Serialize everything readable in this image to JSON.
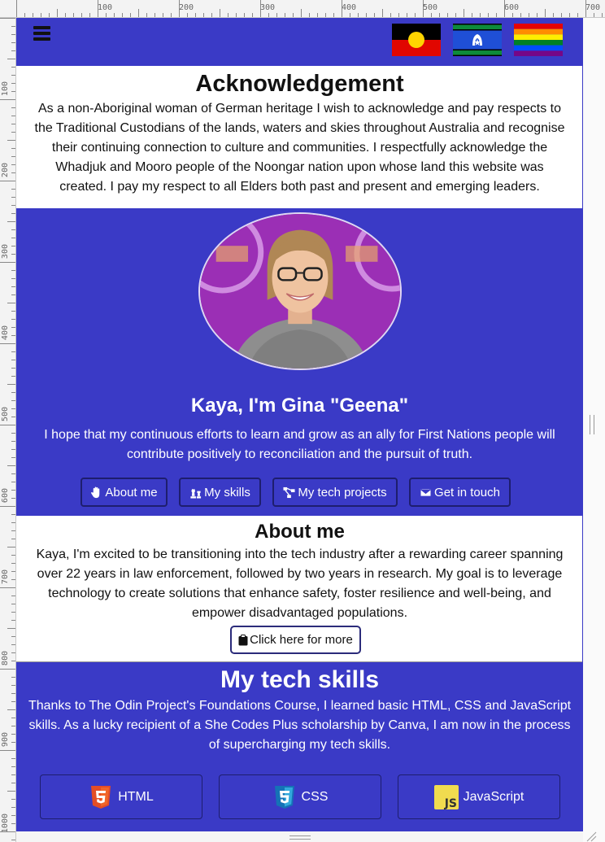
{
  "ruler": {
    "h_labels": [
      "100",
      "200",
      "300",
      "400",
      "500",
      "600",
      "700"
    ],
    "v_labels": [
      "100",
      "200",
      "300",
      "400",
      "500",
      "600",
      "700",
      "800",
      "900",
      "1000"
    ]
  },
  "colors": {
    "brand": "#3a3ac6",
    "button_border": "#1e1e6e",
    "text_on_blue": "#ffffff"
  },
  "nav": {
    "menu_icon": "hamburger-icon",
    "flags": [
      "aboriginal-flag",
      "torres-strait-islander-flag",
      "rainbow-pride-flag"
    ]
  },
  "acknowledgement": {
    "title": "Acknowledgement",
    "text": "As a non-Aboriginal woman of German heritage I wish to acknowledge and pay respects to the Traditional Custodians of the lands, waters and skies throughout Australia and recognise their continuing connection to culture and communities. I respectfully acknowledge the Whadjuk and Mooro people of the Noongar nation upon whose land this website was created. I pay my respect to all Elders both past and present and emerging leaders."
  },
  "hero": {
    "greeting": "Kaya, I'm Gina \"Geena\"",
    "tagline": "I hope that my continuous efforts to learn and grow as an ally for First Nations people will contribute positively to reconciliation and the pursuit of truth.",
    "buttons": [
      {
        "label": "About me",
        "icon": "hand-icon"
      },
      {
        "label": "My skills",
        "icon": "chess-icon"
      },
      {
        "label": "My tech projects",
        "icon": "sitemap-icon"
      },
      {
        "label": "Get in touch",
        "icon": "envelope-icon"
      }
    ]
  },
  "about": {
    "title": "About me",
    "text": "Kaya, I'm excited to be transitioning into the tech industry after a rewarding career spanning over 22 years in law enforcement, followed by two years in research. My goal is to leverage technology to create solutions that enhance safety, foster resilience and well-being, and empower disadvantaged populations.",
    "more_button": "Click here for more",
    "more_icon": "clipboard-icon"
  },
  "skills": {
    "title": "My tech skills",
    "text": "Thanks to The Odin Project's Foundations Course, I learned basic HTML, CSS and JavaScript skills. As a lucky recipient of a She Codes Plus scholarship by Canva, I am now in the process of supercharging my tech skills.",
    "items": [
      {
        "label": "HTML",
        "icon": "html5-icon",
        "color": "#e44d26"
      },
      {
        "label": "CSS",
        "icon": "css3-icon",
        "color": "#1572b6"
      },
      {
        "label": "JavaScript",
        "icon": "javascript-icon",
        "color": "#f0db4f"
      }
    ]
  }
}
